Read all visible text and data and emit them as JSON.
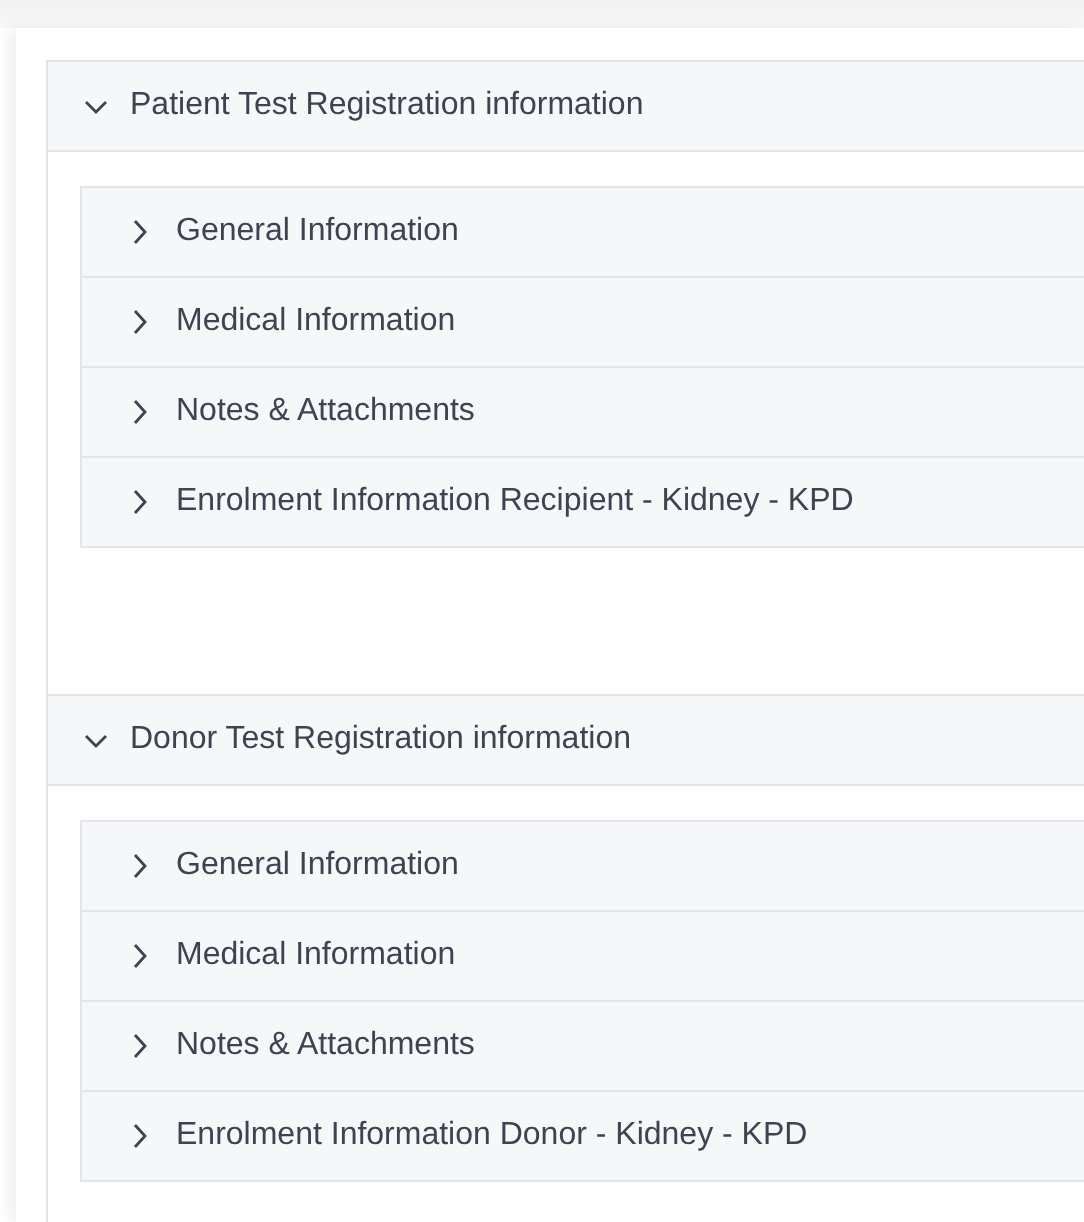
{
  "sections": [
    {
      "title": "Patient Test Registration information",
      "expanded": true,
      "items": [
        {
          "label": "General Information",
          "expanded": false
        },
        {
          "label": "Medical Information",
          "expanded": false
        },
        {
          "label": "Notes & Attachments",
          "expanded": false
        },
        {
          "label": "Enrolment Information Recipient - Kidney - KPD",
          "expanded": false
        }
      ]
    },
    {
      "title": "Donor Test Registration information",
      "expanded": true,
      "items": [
        {
          "label": "General Information",
          "expanded": false
        },
        {
          "label": "Medical Information",
          "expanded": false
        },
        {
          "label": "Notes & Attachments",
          "expanded": false
        },
        {
          "label": "Enrolment Information Donor - Kidney - KPD",
          "expanded": false
        }
      ]
    }
  ]
}
